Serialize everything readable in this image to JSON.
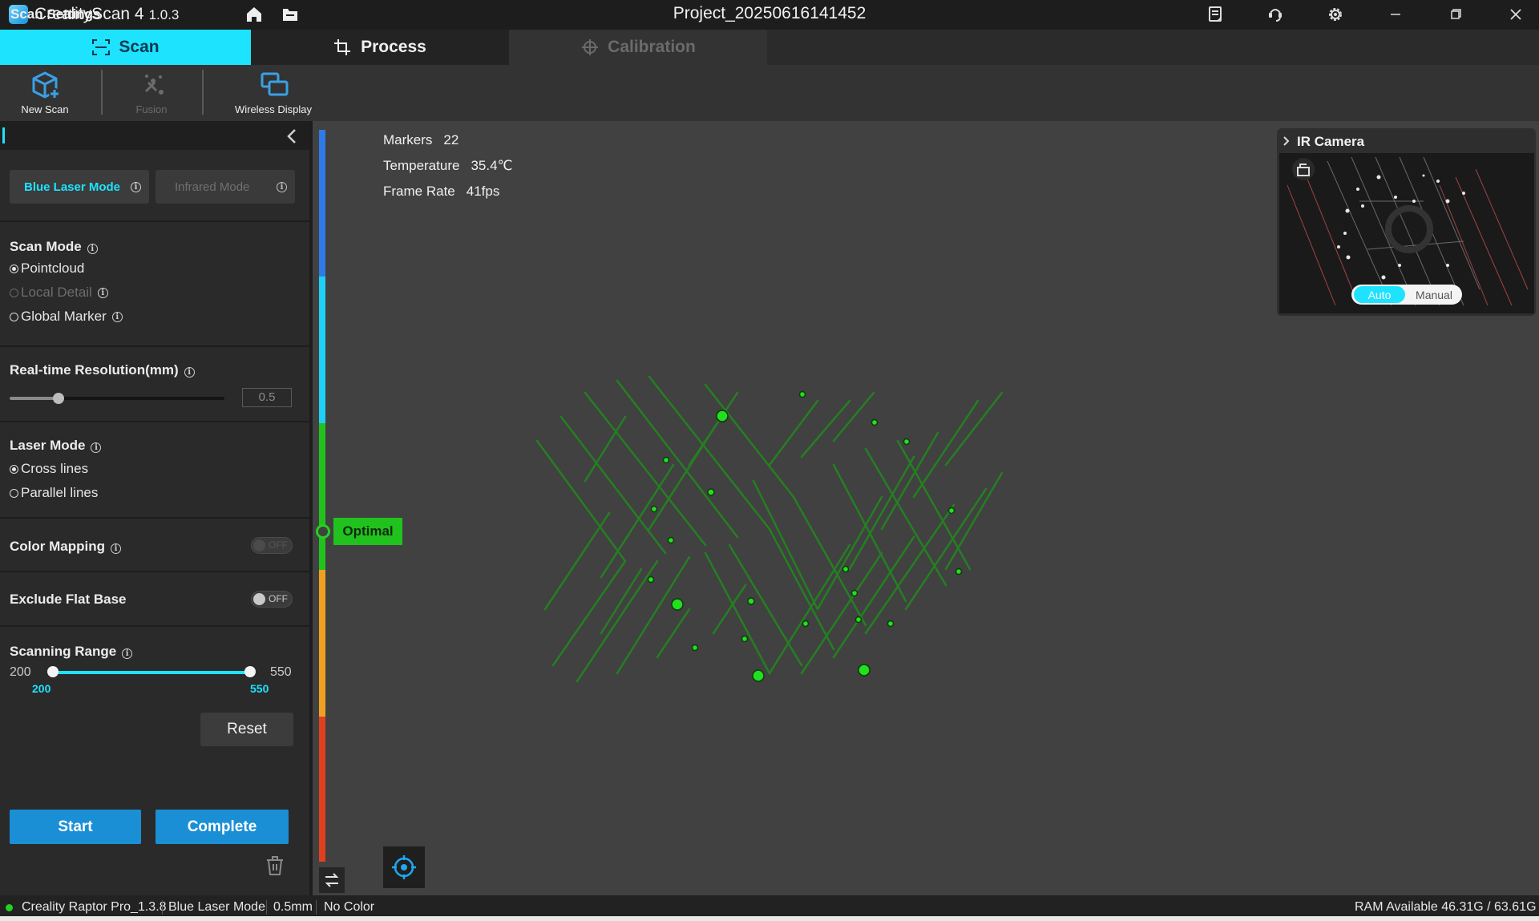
{
  "app": {
    "name": "CrealityScan 4",
    "version": "1.0.3",
    "project_title": "Project_20250616141452"
  },
  "tabs": {
    "scan": "Scan",
    "process": "Process",
    "calibration": "Calibration"
  },
  "toolbar": {
    "new_scan": "New Scan",
    "fusion": "Fusion",
    "wireless_display": "Wireless Display"
  },
  "settings": {
    "title": "Scan Settings",
    "mode_buttons": {
      "blue_laser": "Blue Laser Mode",
      "infrared": "Infrared Mode"
    },
    "scan_mode": {
      "title": "Scan Mode",
      "options": [
        "Pointcloud",
        "Local Detail",
        "Global Marker"
      ],
      "selected": "Pointcloud"
    },
    "resolution": {
      "title": "Real-time Resolution(mm)",
      "value": "0.5"
    },
    "laser_mode": {
      "title": "Laser Mode",
      "options": [
        "Cross lines",
        "Parallel lines"
      ],
      "selected": "Cross lines"
    },
    "color_mapping": {
      "title": "Color Mapping",
      "state": "OFF"
    },
    "exclude_flat_base": {
      "title": "Exclude Flat Base",
      "state": "OFF"
    },
    "scanning_range": {
      "title": "Scanning Range",
      "min": "200",
      "max": "550",
      "low": "200",
      "high": "550"
    },
    "reset": "Reset",
    "start": "Start",
    "complete": "Complete"
  },
  "stats": {
    "markers_label": "Markers",
    "markers_value": "22",
    "temperature_label": "Temperature",
    "temperature_value": "35.4℃",
    "frame_rate_label": "Frame Rate",
    "frame_rate_value": "41fps"
  },
  "gauge": {
    "label": "Optimal",
    "colors": [
      "#2f7be6",
      "#1ed0f5",
      "#22c21e",
      "#f0a020",
      "#e0401e"
    ]
  },
  "ir_camera": {
    "title": "IR Camera",
    "auto": "Auto",
    "manual": "Manual"
  },
  "status_bar": {
    "device": "Creality Raptor Pro_1.3.8",
    "mode": "Blue Laser Mode",
    "resolution": "0.5mm",
    "color": "No Color",
    "ram": "RAM Available 46.31G / 63.61G"
  },
  "colors": {
    "accent": "#1ee3ff",
    "primary_button": "#1b8fd6",
    "point_green": "#22d21e"
  }
}
